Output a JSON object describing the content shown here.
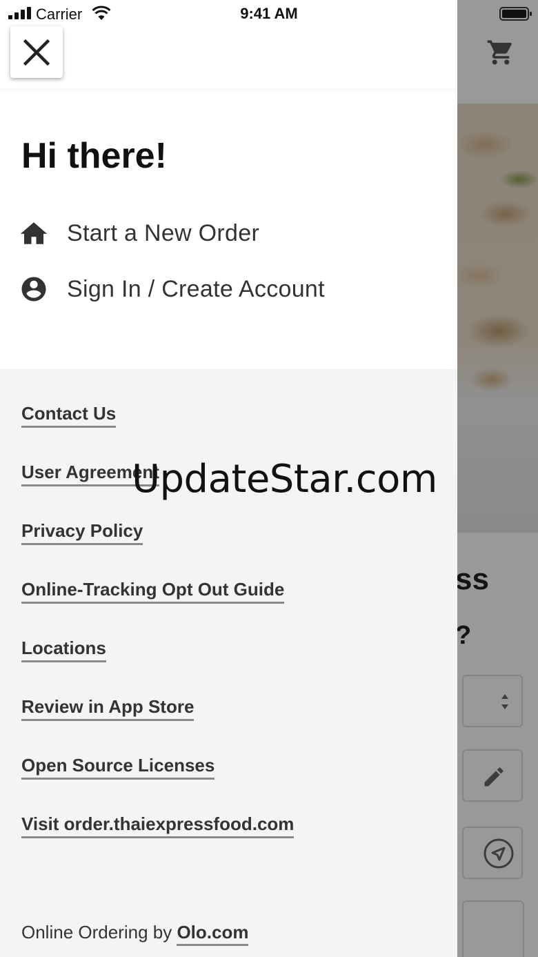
{
  "status_bar": {
    "carrier": "Carrier",
    "time": "9:41 AM"
  },
  "background": {
    "heading_partial": "ss",
    "question_partial": "?"
  },
  "drawer": {
    "greeting": "Hi there!",
    "menu": [
      {
        "label": "Start a New Order",
        "icon": "home-icon"
      },
      {
        "label": "Sign In / Create Account",
        "icon": "account-circle-icon"
      }
    ],
    "links": [
      "Contact Us",
      "User Agreement",
      "Privacy Policy",
      "Online-Tracking Opt Out Guide",
      "Locations",
      "Review in App Store",
      "Open Source Licenses",
      "Visit order.thaiexpressfood.com"
    ],
    "footer": {
      "prefix": "Online Ordering by ",
      "link": "Olo.com"
    }
  },
  "watermark": "UpdateStar.com"
}
